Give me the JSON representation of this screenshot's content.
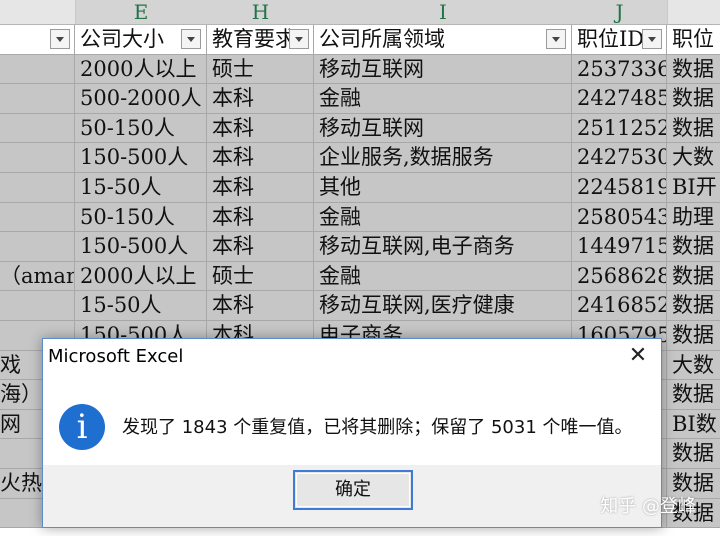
{
  "columns": [
    "E",
    "H",
    "I",
    "J"
  ],
  "header_row": {
    "c0": "",
    "c1": "公司大小",
    "c2": "教育要求",
    "c3": "公司所属领域",
    "c4": "职位ID",
    "c5": "职位"
  },
  "rows": [
    {
      "c0": "",
      "c1": "2000人以上",
      "c2": "硕士",
      "c3": "移动互联网",
      "c4": "2537336",
      "c5": "数据"
    },
    {
      "c0": "",
      "c1": "500-2000人",
      "c2": "本科",
      "c3": "金融",
      "c4": "2427485",
      "c5": "数据"
    },
    {
      "c0": "",
      "c1": "50-150人",
      "c2": "本科",
      "c3": "移动互联网",
      "c4": "2511252",
      "c5": "数据"
    },
    {
      "c0": "",
      "c1": "150-500人",
      "c2": "本科",
      "c3": "企业服务,数据服务",
      "c4": "2427530",
      "c5": "大数"
    },
    {
      "c0": "",
      "c1": "15-50人",
      "c2": "本科",
      "c3": "其他",
      "c4": "2245819",
      "c5": "BI开"
    },
    {
      "c0": "",
      "c1": "50-150人",
      "c2": "本科",
      "c3": "金融",
      "c4": "2580543",
      "c5": "助理"
    },
    {
      "c0": "",
      "c1": "150-500人",
      "c2": "本科",
      "c3": "移动互联网,电子商务",
      "c4": "1449715",
      "c5": "数据"
    },
    {
      "c0": "（amars",
      "c1": "2000人以上",
      "c2": "硕士",
      "c3": "金融",
      "c4": "2568628",
      "c5": "数据"
    },
    {
      "c0": "",
      "c1": "15-50人",
      "c2": "本科",
      "c3": "移动互联网,医疗健康",
      "c4": "2416852",
      "c5": "数据"
    },
    {
      "c0": "",
      "c1": "150-500人",
      "c2": "本科",
      "c3": "电子商务",
      "c4": "1605795",
      "c5": "数据"
    },
    {
      "c0": "戏",
      "c1": "",
      "c2": "",
      "c3": "",
      "c4": "",
      "c5": "大数"
    },
    {
      "c0": "海）",
      "c1": "",
      "c2": "",
      "c3": "",
      "c4": "",
      "c5": "数据"
    },
    {
      "c0": "网",
      "c1": "",
      "c2": "",
      "c3": "",
      "c4": "",
      "c5": "BI数"
    },
    {
      "c0": "",
      "c1": "",
      "c2": "",
      "c3": "",
      "c4": "",
      "c5": "数据"
    },
    {
      "c0": "火热",
      "c1": "",
      "c2": "",
      "c3": "",
      "c4": "",
      "c5": "数据"
    },
    {
      "c0": "",
      "c1": "",
      "c2": "",
      "c3": "",
      "c4": "",
      "c5": "数据"
    },
    {
      "c0": "",
      "c1": "",
      "c2": "",
      "c3": "",
      "c4": "",
      "c5": ""
    }
  ],
  "dialog": {
    "title": "Microsoft Excel",
    "close_glyph": "✕",
    "message": "发现了 1843 个重复值，已将其删除；保留了 5031 个唯一值。",
    "ok_label": "确定",
    "icon": "info-icon",
    "icon_glyph": "i"
  },
  "watermark": "知乎 @登峰",
  "colors": {
    "selection": "#c6c6c6",
    "header_text": "#217346",
    "info_blue": "#1e6fd0",
    "dialog_border": "#5b8ccc"
  }
}
